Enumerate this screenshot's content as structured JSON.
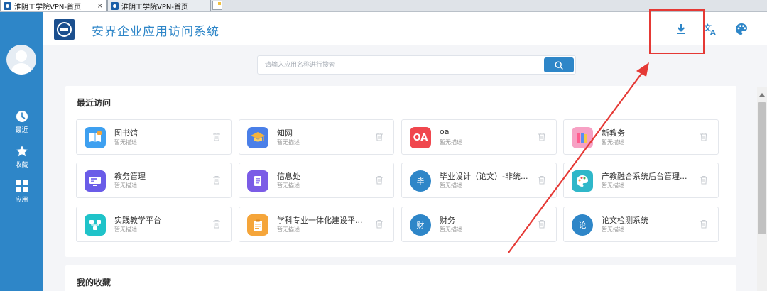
{
  "browser_tabs": [
    {
      "title": "淮阴工学院VPN-首页",
      "close": "×",
      "active": true
    },
    {
      "title": "淮阴工学院VPN-首页",
      "active": false
    }
  ],
  "sidebar": {
    "items": [
      {
        "label": "最近",
        "icon": "clock-icon"
      },
      {
        "label": "收藏",
        "icon": "star-icon"
      },
      {
        "label": "应用",
        "icon": "grid-icon"
      }
    ]
  },
  "header": {
    "title": "安界企业应用访问系统",
    "icons": [
      "download-icon",
      "translate-icon",
      "palette-icon"
    ]
  },
  "search": {
    "placeholder": "请输入应用名称进行搜索"
  },
  "recent": {
    "title": "最近访问",
    "apps": [
      {
        "name": "图书馆",
        "desc": "暂无描述",
        "icon": "library-icon"
      },
      {
        "name": "知网",
        "desc": "暂无描述",
        "icon": "graduation-cap-icon"
      },
      {
        "name": "oa",
        "desc": "暂无描述",
        "icon_text": "OA"
      },
      {
        "name": "新教务",
        "desc": "暂无描述",
        "icon": "books-icon"
      },
      {
        "name": "教务管理",
        "desc": "暂无描述",
        "icon": "monitor-icon"
      },
      {
        "name": "信息处",
        "desc": "暂无描述",
        "icon": "document-icon"
      },
      {
        "name": "毕业设计（论文）-非统...",
        "desc": "暂无描述",
        "icon_text": "毕"
      },
      {
        "name": "产教融合系统后台管理...",
        "desc": "暂无描述",
        "icon": "palette-app-icon"
      },
      {
        "name": "实践教学平台",
        "desc": "暂无描述",
        "icon": "network-icon"
      },
      {
        "name": "学科专业一体化建设平...",
        "desc": "暂无描述",
        "icon": "clipboard-icon"
      },
      {
        "name": "财务",
        "desc": "暂无描述",
        "icon_text": "财"
      },
      {
        "name": "论文检测系统",
        "desc": "暂无描述",
        "icon_text": "论"
      }
    ]
  },
  "favorites": {
    "title": "我的收藏"
  },
  "colors": {
    "primary": "#2e86c8",
    "annotation": "#e53935"
  }
}
